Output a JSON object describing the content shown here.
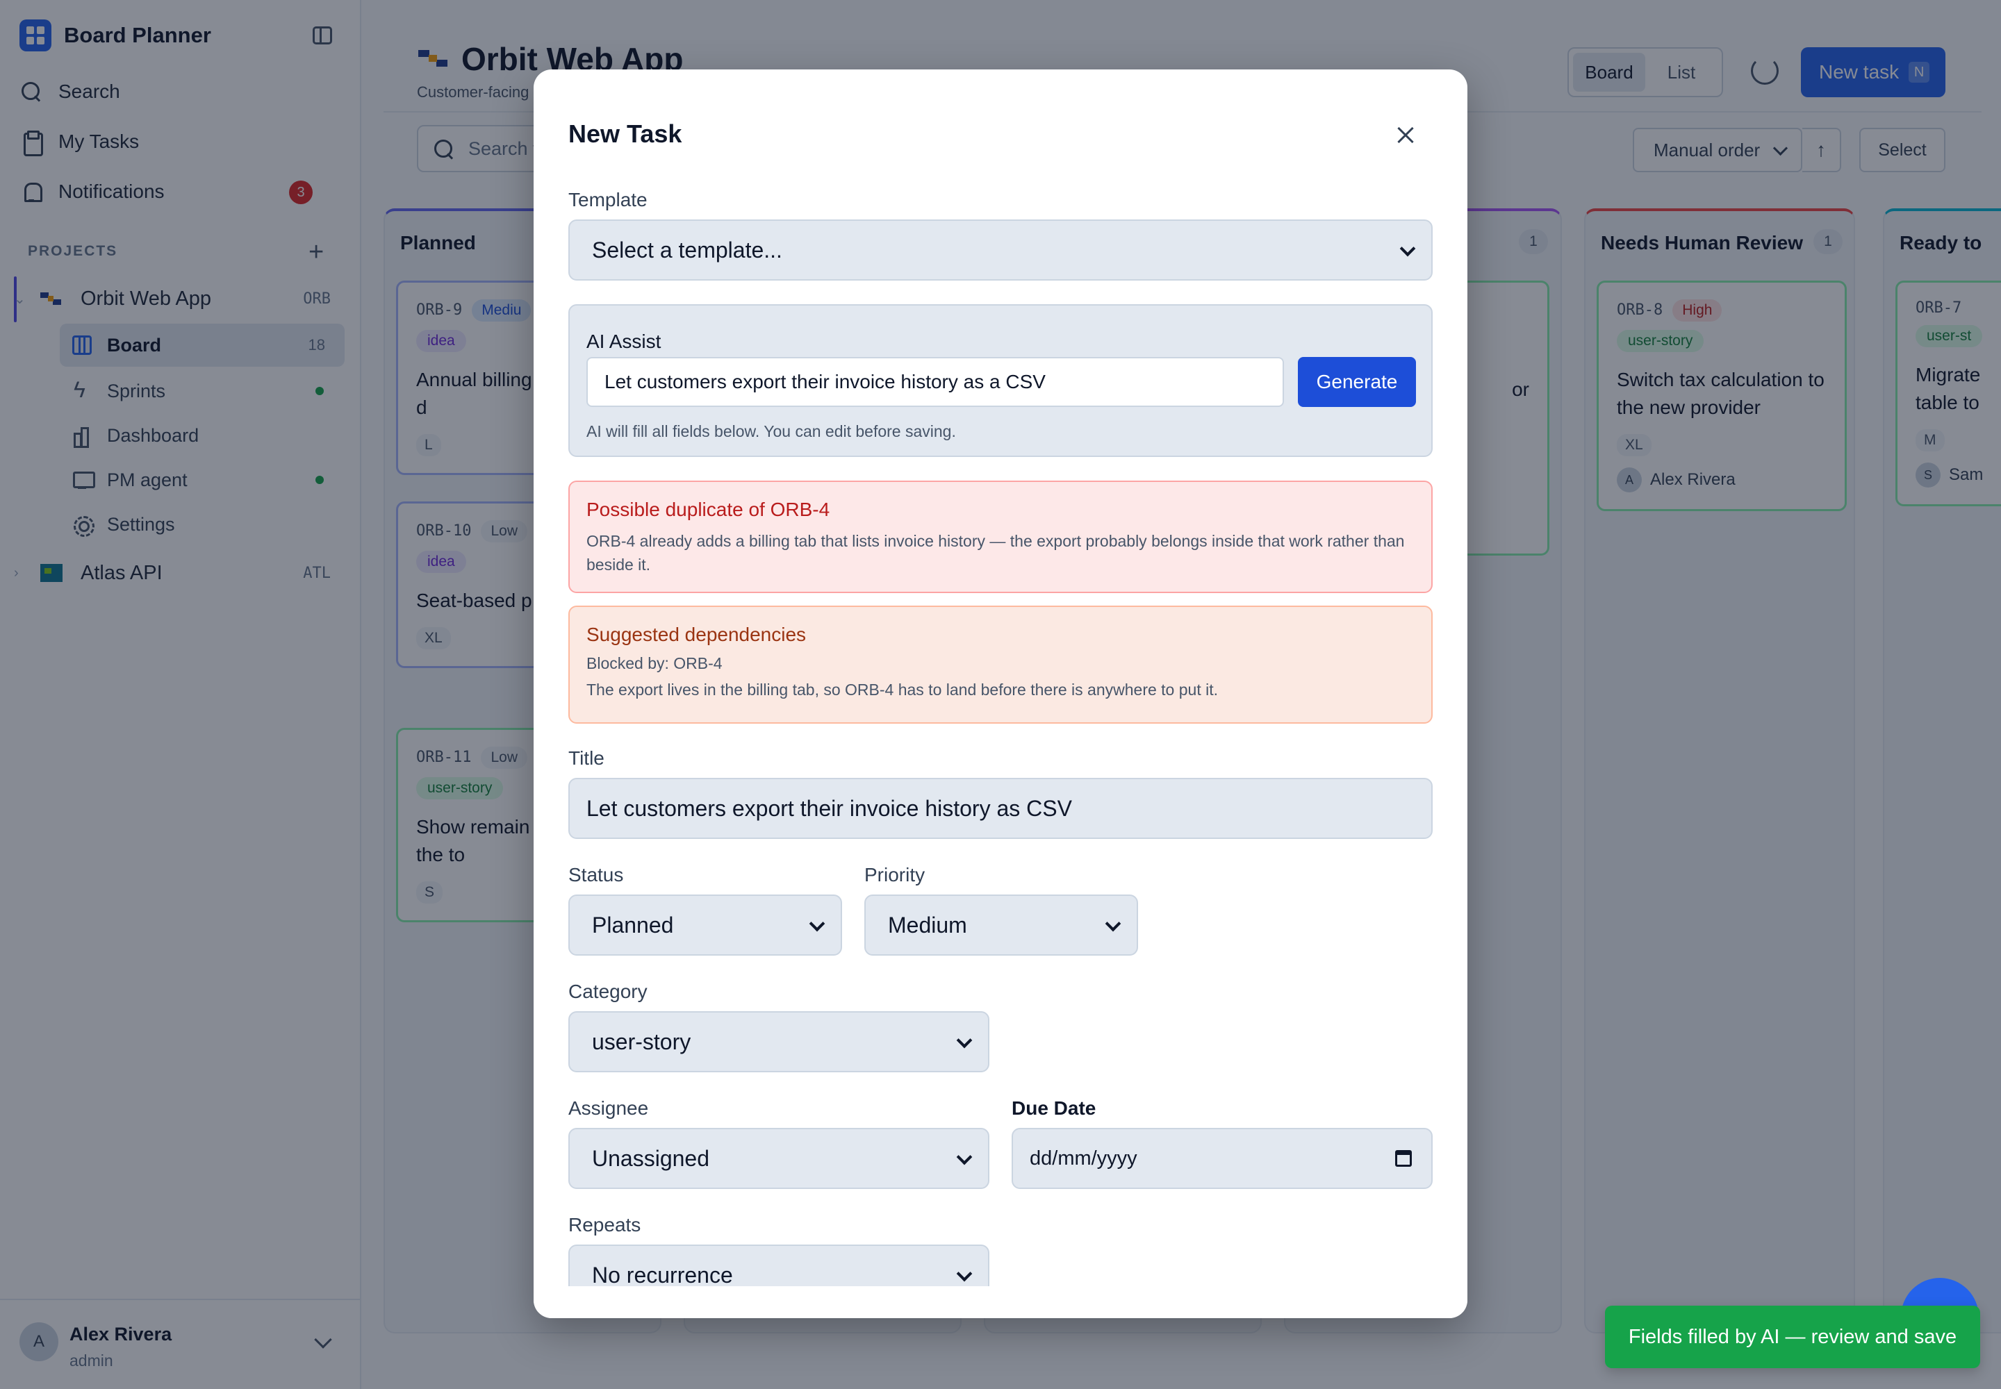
{
  "app": {
    "name": "Board Planner"
  },
  "nav": {
    "search": "Search",
    "my_tasks": "My Tasks",
    "notifications": "Notifications",
    "notifications_count": "3"
  },
  "projects": {
    "label": "PROJECTS",
    "items": [
      {
        "name": "Orbit Web App",
        "key": "ORB",
        "sub": [
          {
            "label": "Board",
            "count": "18"
          },
          {
            "label": "Sprints"
          },
          {
            "label": "Dashboard"
          },
          {
            "label": "PM agent"
          },
          {
            "label": "Settings"
          }
        ]
      },
      {
        "name": "Atlas API",
        "key": "ATL"
      }
    ]
  },
  "user": {
    "name": "Alex Rivera",
    "role": "admin",
    "initial": "A"
  },
  "header": {
    "title": "Orbit Web App",
    "subtitle": "Customer-facing",
    "view_board": "Board",
    "view_list": "List",
    "new_task": "New task",
    "new_task_kbd": "N"
  },
  "toolbar": {
    "search_placeholder": "Search t",
    "sort": "Manual order",
    "sort_dir": "↑",
    "select": "Select"
  },
  "columns": [
    {
      "name": "Planned",
      "cards": [
        {
          "id": "ORB-9",
          "priority": "Mediu",
          "category": "idea",
          "title": "Annual billing two-month d",
          "size": "L"
        },
        {
          "id": "ORB-10",
          "priority": "Low",
          "category": "idea",
          "title": "Seat-based p teams",
          "size": "XL"
        },
        {
          "id": "ORB-11",
          "priority": "Low",
          "category": "user-story",
          "title": "Show remain days in the to",
          "size": "S"
        }
      ]
    },
    {
      "name": "",
      "count": "1",
      "partial_text": "or"
    },
    {
      "name": "Needs Human Review",
      "count": "1",
      "cards": [
        {
          "id": "ORB-8",
          "priority": "High",
          "category": "user-story",
          "title": "Switch tax calculation to the new provider",
          "size": "XL",
          "assignee": "Alex Rivera",
          "assignee_initial": "A"
        }
      ]
    },
    {
      "name": "Ready to",
      "cards": [
        {
          "id": "ORB-7",
          "category": "user-st",
          "title": "Migrate table to",
          "size": "M",
          "assignee": "Sam",
          "assignee_initial": "S"
        }
      ]
    }
  ],
  "modal": {
    "title": "New Task",
    "template_label": "Template",
    "template_value": "Select a template...",
    "ai": {
      "label": "AI Assist",
      "input": "Let customers export their invoice history as a CSV",
      "generate": "Generate",
      "hint": "AI will fill all fields below. You can edit before saving."
    },
    "duplicate": {
      "title": "Possible duplicate of ORB-4",
      "body": "ORB-4 already adds a billing tab that lists invoice history — the export probably belongs inside that work rather than beside it."
    },
    "dependencies": {
      "title": "Suggested dependencies",
      "blocked_by": "Blocked by: ORB-4",
      "body": "The export lives in the billing tab, so ORB-4 has to land before there is anywhere to put it."
    },
    "title_label": "Title",
    "title_value": "Let customers export their invoice history as CSV",
    "status_label": "Status",
    "status_value": "Planned",
    "priority_label": "Priority",
    "priority_value": "Medium",
    "category_label": "Category",
    "category_value": "user-story",
    "assignee_label": "Assignee",
    "assignee_value": "Unassigned",
    "due_label": "Due Date",
    "due_value": "dd/mm/yyyy",
    "repeats_label": "Repeats",
    "repeats_value": "No recurrence"
  },
  "toast": "Fields filled by AI — review and save",
  "colors": {
    "accent": "#2563eb",
    "danger": "#dc2626",
    "success": "#16a34a",
    "warning": "#9a3412"
  }
}
